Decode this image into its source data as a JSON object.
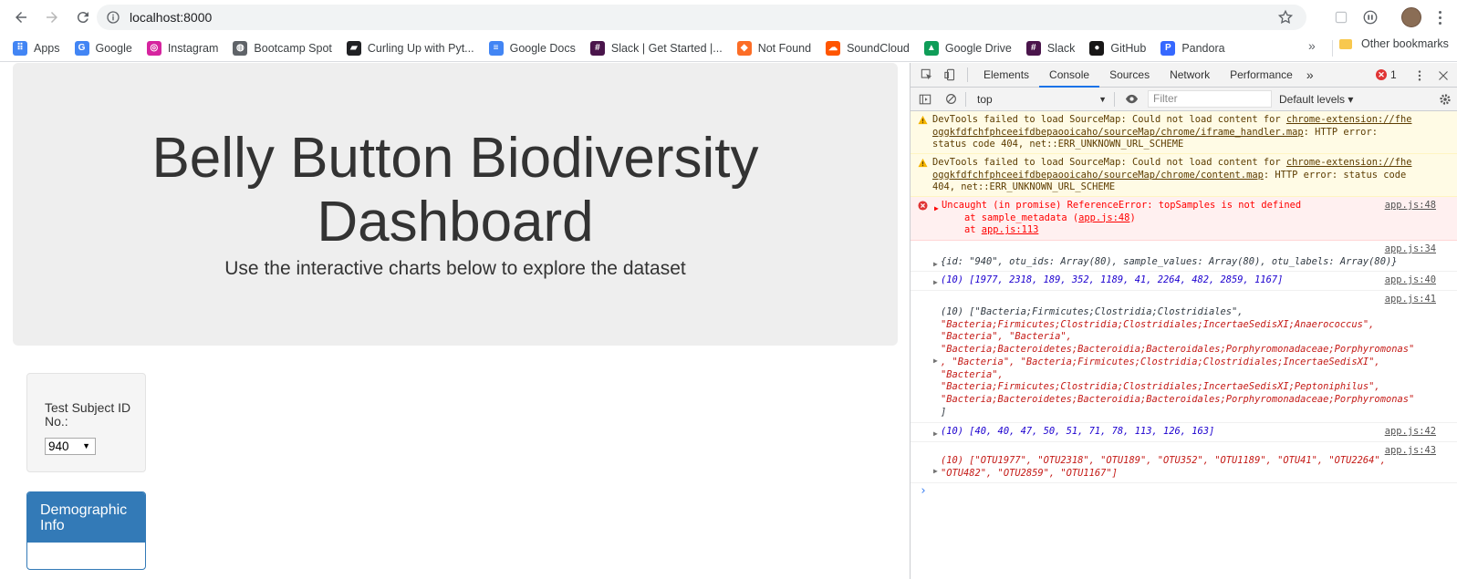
{
  "browser": {
    "url": "localhost:8000",
    "bookmarks": [
      {
        "label": "Apps",
        "icon": "apps-grid-icon",
        "color": "#4285f4"
      },
      {
        "label": "Google",
        "icon": "google-icon",
        "color": "#4285f4"
      },
      {
        "label": "Instagram",
        "icon": "instagram-icon",
        "color": "#d6249f"
      },
      {
        "label": "Bootcamp Spot",
        "icon": "globe-icon",
        "color": "#5f6368"
      },
      {
        "label": "Curling Up with Pyt...",
        "icon": "book-icon",
        "color": "#202124"
      },
      {
        "label": "Google Docs",
        "icon": "google-docs-icon",
        "color": "#4285f4"
      },
      {
        "label": "Slack | Get Started |...",
        "icon": "slack-icon",
        "color": "#4a154b"
      },
      {
        "label": "Not Found",
        "icon": "gitlab-icon",
        "color": "#fc6d26"
      },
      {
        "label": "SoundCloud",
        "icon": "soundcloud-icon",
        "color": "#ff5500"
      },
      {
        "label": "Google Drive",
        "icon": "google-drive-icon",
        "color": "#0f9d58"
      },
      {
        "label": "Slack",
        "icon": "slack-icon",
        "color": "#4a154b"
      },
      {
        "label": "GitHub",
        "icon": "github-icon",
        "color": "#181717"
      },
      {
        "label": "Pandora",
        "icon": "pandora-icon",
        "color": "#3668ff"
      }
    ],
    "other_bookmarks": "Other bookmarks",
    "more_chevron": "»"
  },
  "page": {
    "title": "Belly Button Biodiversity Dashboard",
    "subtitle": "Use the interactive charts below to explore the dataset",
    "selector_label": "Test Subject ID No.:",
    "selected_id": "940",
    "panel_heading": "Demographic Info"
  },
  "devtools": {
    "tabs": [
      "Elements",
      "Console",
      "Sources",
      "Network",
      "Performance"
    ],
    "active_tab": "Console",
    "more_tabs": "»",
    "error_count": "1",
    "context": "top",
    "filter_placeholder": "Filter",
    "levels": "Default levels ▾",
    "messages": {
      "warn1": {
        "l1": "DevTools failed to load SourceMap: Could not load content for ",
        "link1": "chrome-extension://fhe",
        "l2link": "oggkfdfchfphceeifdbepaooicaho/sourceMap/chrome/iframe_handler.map",
        "l2rest": ": HTTP error:",
        "l3": "status code 404, net::ERR_UNKNOWN_URL_SCHEME"
      },
      "warn2": {
        "l1": "DevTools failed to load SourceMap: Could not load content for ",
        "link1": "chrome-extension://fhe",
        "l2link": "oggkfdfchfphceeifdbepaooicaho/sourceMap/chrome/content.map",
        "l2rest": ": HTTP error: status code",
        "l3": "404, net::ERR_UNKNOWN_URL_SCHEME"
      },
      "error": {
        "l1": "Uncaught (in promise) ReferenceError: topSamples is not defined",
        "l2a": "    at sample_metadata (",
        "l2link": "app.js:48",
        "l2b": ")",
        "l3a": "    at ",
        "l3link": "app.js:113",
        "src": "app.js:48"
      },
      "log34": {
        "src": "app.js:34",
        "text": "{id: \"940\", otu_ids: Array(80), sample_values: Array(80), otu_labels: Array(80)}"
      },
      "log40": {
        "src": "app.js:40",
        "text": "(10) [1977, 2318, 189, 352, 1189, 41, 2264, 482, 2859, 1167]"
      },
      "log41": {
        "src": "app.js:41",
        "lines": [
          "(10) [\"Bacteria;Firmicutes;Clostridia;Clostridiales\",",
          "\"Bacteria;Firmicutes;Clostridia;Clostridiales;IncertaeSedisXI;Anaerococcus\",",
          "\"Bacteria\", \"Bacteria\",",
          "\"Bacteria;Bacteroidetes;Bacteroidia;Bacteroidales;Porphyromonadaceae;Porphyromonas\"",
          ", \"Bacteria\", \"Bacteria;Firmicutes;Clostridia;Clostridiales;IncertaeSedisXI\",",
          "\"Bacteria\",",
          "\"Bacteria;Firmicutes;Clostridia;Clostridiales;IncertaeSedisXI;Peptoniphilus\",",
          "\"Bacteria;Bacteroidetes;Bacteroidia;Bacteroidales;Porphyromonadaceae;Porphyromonas\"",
          "]"
        ]
      },
      "log42": {
        "src": "app.js:42",
        "text": "(10) [40, 40, 47, 50, 51, 71, 78, 113, 126, 163]"
      },
      "log43": {
        "src": "app.js:43",
        "l1": "(10) [\"OTU1977\", \"OTU2318\", \"OTU189\", \"OTU352\", \"OTU1189\", \"OTU41\", \"OTU2264\",",
        "l2": "\"OTU482\", \"OTU2859\", \"OTU1167\"]"
      }
    },
    "prompt": "›"
  }
}
